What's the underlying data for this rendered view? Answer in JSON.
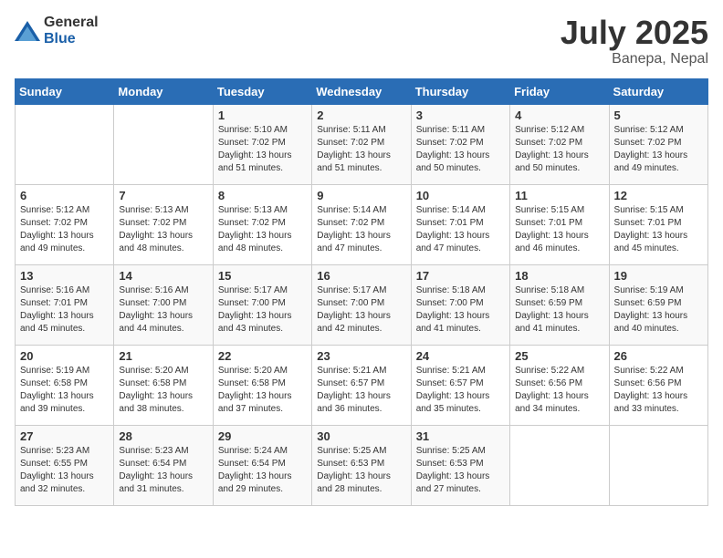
{
  "header": {
    "logo": {
      "general": "General",
      "blue": "Blue"
    },
    "title": "July 2025",
    "location": "Banepa, Nepal"
  },
  "weekdays": [
    "Sunday",
    "Monday",
    "Tuesday",
    "Wednesday",
    "Thursday",
    "Friday",
    "Saturday"
  ],
  "weeks": [
    [
      {
        "day": "",
        "sunrise": "",
        "sunset": "",
        "daylight": ""
      },
      {
        "day": "",
        "sunrise": "",
        "sunset": "",
        "daylight": ""
      },
      {
        "day": "1",
        "sunrise": "Sunrise: 5:10 AM",
        "sunset": "Sunset: 7:02 PM",
        "daylight": "Daylight: 13 hours and 51 minutes."
      },
      {
        "day": "2",
        "sunrise": "Sunrise: 5:11 AM",
        "sunset": "Sunset: 7:02 PM",
        "daylight": "Daylight: 13 hours and 51 minutes."
      },
      {
        "day": "3",
        "sunrise": "Sunrise: 5:11 AM",
        "sunset": "Sunset: 7:02 PM",
        "daylight": "Daylight: 13 hours and 50 minutes."
      },
      {
        "day": "4",
        "sunrise": "Sunrise: 5:12 AM",
        "sunset": "Sunset: 7:02 PM",
        "daylight": "Daylight: 13 hours and 50 minutes."
      },
      {
        "day": "5",
        "sunrise": "Sunrise: 5:12 AM",
        "sunset": "Sunset: 7:02 PM",
        "daylight": "Daylight: 13 hours and 49 minutes."
      }
    ],
    [
      {
        "day": "6",
        "sunrise": "Sunrise: 5:12 AM",
        "sunset": "Sunset: 7:02 PM",
        "daylight": "Daylight: 13 hours and 49 minutes."
      },
      {
        "day": "7",
        "sunrise": "Sunrise: 5:13 AM",
        "sunset": "Sunset: 7:02 PM",
        "daylight": "Daylight: 13 hours and 48 minutes."
      },
      {
        "day": "8",
        "sunrise": "Sunrise: 5:13 AM",
        "sunset": "Sunset: 7:02 PM",
        "daylight": "Daylight: 13 hours and 48 minutes."
      },
      {
        "day": "9",
        "sunrise": "Sunrise: 5:14 AM",
        "sunset": "Sunset: 7:02 PM",
        "daylight": "Daylight: 13 hours and 47 minutes."
      },
      {
        "day": "10",
        "sunrise": "Sunrise: 5:14 AM",
        "sunset": "Sunset: 7:01 PM",
        "daylight": "Daylight: 13 hours and 47 minutes."
      },
      {
        "day": "11",
        "sunrise": "Sunrise: 5:15 AM",
        "sunset": "Sunset: 7:01 PM",
        "daylight": "Daylight: 13 hours and 46 minutes."
      },
      {
        "day": "12",
        "sunrise": "Sunrise: 5:15 AM",
        "sunset": "Sunset: 7:01 PM",
        "daylight": "Daylight: 13 hours and 45 minutes."
      }
    ],
    [
      {
        "day": "13",
        "sunrise": "Sunrise: 5:16 AM",
        "sunset": "Sunset: 7:01 PM",
        "daylight": "Daylight: 13 hours and 45 minutes."
      },
      {
        "day": "14",
        "sunrise": "Sunrise: 5:16 AM",
        "sunset": "Sunset: 7:00 PM",
        "daylight": "Daylight: 13 hours and 44 minutes."
      },
      {
        "day": "15",
        "sunrise": "Sunrise: 5:17 AM",
        "sunset": "Sunset: 7:00 PM",
        "daylight": "Daylight: 13 hours and 43 minutes."
      },
      {
        "day": "16",
        "sunrise": "Sunrise: 5:17 AM",
        "sunset": "Sunset: 7:00 PM",
        "daylight": "Daylight: 13 hours and 42 minutes."
      },
      {
        "day": "17",
        "sunrise": "Sunrise: 5:18 AM",
        "sunset": "Sunset: 7:00 PM",
        "daylight": "Daylight: 13 hours and 41 minutes."
      },
      {
        "day": "18",
        "sunrise": "Sunrise: 5:18 AM",
        "sunset": "Sunset: 6:59 PM",
        "daylight": "Daylight: 13 hours and 41 minutes."
      },
      {
        "day": "19",
        "sunrise": "Sunrise: 5:19 AM",
        "sunset": "Sunset: 6:59 PM",
        "daylight": "Daylight: 13 hours and 40 minutes."
      }
    ],
    [
      {
        "day": "20",
        "sunrise": "Sunrise: 5:19 AM",
        "sunset": "Sunset: 6:58 PM",
        "daylight": "Daylight: 13 hours and 39 minutes."
      },
      {
        "day": "21",
        "sunrise": "Sunrise: 5:20 AM",
        "sunset": "Sunset: 6:58 PM",
        "daylight": "Daylight: 13 hours and 38 minutes."
      },
      {
        "day": "22",
        "sunrise": "Sunrise: 5:20 AM",
        "sunset": "Sunset: 6:58 PM",
        "daylight": "Daylight: 13 hours and 37 minutes."
      },
      {
        "day": "23",
        "sunrise": "Sunrise: 5:21 AM",
        "sunset": "Sunset: 6:57 PM",
        "daylight": "Daylight: 13 hours and 36 minutes."
      },
      {
        "day": "24",
        "sunrise": "Sunrise: 5:21 AM",
        "sunset": "Sunset: 6:57 PM",
        "daylight": "Daylight: 13 hours and 35 minutes."
      },
      {
        "day": "25",
        "sunrise": "Sunrise: 5:22 AM",
        "sunset": "Sunset: 6:56 PM",
        "daylight": "Daylight: 13 hours and 34 minutes."
      },
      {
        "day": "26",
        "sunrise": "Sunrise: 5:22 AM",
        "sunset": "Sunset: 6:56 PM",
        "daylight": "Daylight: 13 hours and 33 minutes."
      }
    ],
    [
      {
        "day": "27",
        "sunrise": "Sunrise: 5:23 AM",
        "sunset": "Sunset: 6:55 PM",
        "daylight": "Daylight: 13 hours and 32 minutes."
      },
      {
        "day": "28",
        "sunrise": "Sunrise: 5:23 AM",
        "sunset": "Sunset: 6:54 PM",
        "daylight": "Daylight: 13 hours and 31 minutes."
      },
      {
        "day": "29",
        "sunrise": "Sunrise: 5:24 AM",
        "sunset": "Sunset: 6:54 PM",
        "daylight": "Daylight: 13 hours and 29 minutes."
      },
      {
        "day": "30",
        "sunrise": "Sunrise: 5:25 AM",
        "sunset": "Sunset: 6:53 PM",
        "daylight": "Daylight: 13 hours and 28 minutes."
      },
      {
        "day": "31",
        "sunrise": "Sunrise: 5:25 AM",
        "sunset": "Sunset: 6:53 PM",
        "daylight": "Daylight: 13 hours and 27 minutes."
      },
      {
        "day": "",
        "sunrise": "",
        "sunset": "",
        "daylight": ""
      },
      {
        "day": "",
        "sunrise": "",
        "sunset": "",
        "daylight": ""
      }
    ]
  ]
}
